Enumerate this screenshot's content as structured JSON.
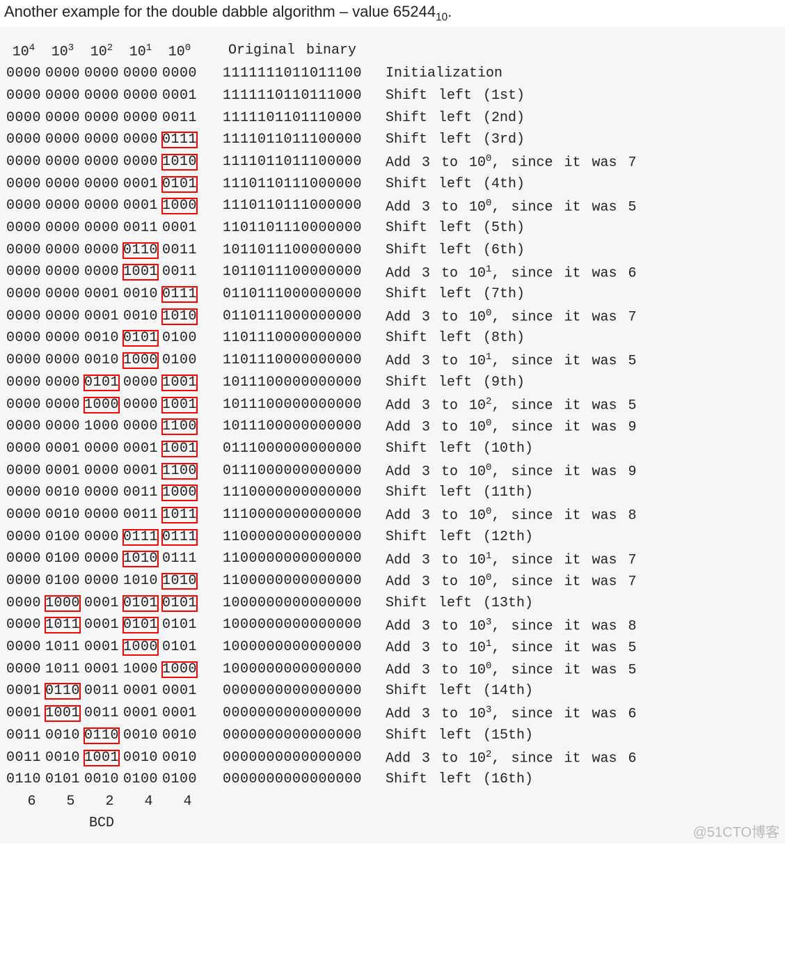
{
  "title_pre": "Another example for the double dabble algorithm – value 65244",
  "title_sub": "10",
  "title_post": ".",
  "header": {
    "cols": [
      "10",
      "10",
      "10",
      "10",
      "10"
    ],
    "exps": [
      "4",
      "3",
      "2",
      "1",
      "0"
    ],
    "bin": "Original binary"
  },
  "rows": [
    {
      "bcd": [
        "0000",
        "0000",
        "0000",
        "0000",
        "0000"
      ],
      "box": [
        0,
        0,
        0,
        0,
        0
      ],
      "bin": "1111111011011100",
      "desc": "Initialization"
    },
    {
      "bcd": [
        "0000",
        "0000",
        "0000",
        "0000",
        "0001"
      ],
      "box": [
        0,
        0,
        0,
        0,
        0
      ],
      "bin": "1111110110111000",
      "desc": "Shift left (1st)"
    },
    {
      "bcd": [
        "0000",
        "0000",
        "0000",
        "0000",
        "0011"
      ],
      "box": [
        0,
        0,
        0,
        0,
        0
      ],
      "bin": "1111101101110000",
      "desc": "Shift left (2nd)"
    },
    {
      "bcd": [
        "0000",
        "0000",
        "0000",
        "0000",
        "0111"
      ],
      "box": [
        0,
        0,
        0,
        0,
        1
      ],
      "bin": "1111011011100000",
      "desc": "Shift left (3rd)"
    },
    {
      "bcd": [
        "0000",
        "0000",
        "0000",
        "0000",
        "1010"
      ],
      "box": [
        0,
        0,
        0,
        0,
        1
      ],
      "bin": "1111011011100000",
      "desc": "Add 3 to 10",
      "exp": "0",
      "tail": ", since it was 7"
    },
    {
      "bcd": [
        "0000",
        "0000",
        "0000",
        "0001",
        "0101"
      ],
      "box": [
        0,
        0,
        0,
        0,
        1
      ],
      "bin": "1110110111000000",
      "desc": "Shift left (4th)"
    },
    {
      "bcd": [
        "0000",
        "0000",
        "0000",
        "0001",
        "1000"
      ],
      "box": [
        0,
        0,
        0,
        0,
        1
      ],
      "bin": "1110110111000000",
      "desc": "Add 3 to 10",
      "exp": "0",
      "tail": ", since it was 5"
    },
    {
      "bcd": [
        "0000",
        "0000",
        "0000",
        "0011",
        "0001"
      ],
      "box": [
        0,
        0,
        0,
        0,
        0
      ],
      "bin": "1101101110000000",
      "desc": "Shift left (5th)"
    },
    {
      "bcd": [
        "0000",
        "0000",
        "0000",
        "0110",
        "0011"
      ],
      "box": [
        0,
        0,
        0,
        1,
        0
      ],
      "bin": "1011011100000000",
      "desc": "Shift left (6th)"
    },
    {
      "bcd": [
        "0000",
        "0000",
        "0000",
        "1001",
        "0011"
      ],
      "box": [
        0,
        0,
        0,
        1,
        0
      ],
      "bin": "1011011100000000",
      "desc": "Add 3 to 10",
      "exp": "1",
      "tail": ", since it was 6"
    },
    {
      "bcd": [
        "0000",
        "0000",
        "0001",
        "0010",
        "0111"
      ],
      "box": [
        0,
        0,
        0,
        0,
        1
      ],
      "bin": "0110111000000000",
      "desc": "Shift left (7th)"
    },
    {
      "bcd": [
        "0000",
        "0000",
        "0001",
        "0010",
        "1010"
      ],
      "box": [
        0,
        0,
        0,
        0,
        1
      ],
      "bin": "0110111000000000",
      "desc": "Add 3 to 10",
      "exp": "0",
      "tail": ", since it was 7"
    },
    {
      "bcd": [
        "0000",
        "0000",
        "0010",
        "0101",
        "0100"
      ],
      "box": [
        0,
        0,
        0,
        1,
        0
      ],
      "bin": "1101110000000000",
      "desc": "Shift left (8th)"
    },
    {
      "bcd": [
        "0000",
        "0000",
        "0010",
        "1000",
        "0100"
      ],
      "box": [
        0,
        0,
        0,
        1,
        0
      ],
      "bin": "1101110000000000",
      "desc": "Add 3 to 10",
      "exp": "1",
      "tail": ", since it was 5"
    },
    {
      "bcd": [
        "0000",
        "0000",
        "0101",
        "0000",
        "1001"
      ],
      "box": [
        0,
        0,
        1,
        0,
        1
      ],
      "bin": "1011100000000000",
      "desc": "Shift left (9th)"
    },
    {
      "bcd": [
        "0000",
        "0000",
        "1000",
        "0000",
        "1001"
      ],
      "box": [
        0,
        0,
        1,
        0,
        1
      ],
      "bin": "1011100000000000",
      "desc": "Add 3 to 10",
      "exp": "2",
      "tail": ", since it was 5"
    },
    {
      "bcd": [
        "0000",
        "0000",
        "1000",
        "0000",
        "1100"
      ],
      "box": [
        0,
        0,
        0,
        0,
        1
      ],
      "bin": "1011100000000000",
      "desc": "Add 3 to 10",
      "exp": "0",
      "tail": ", since it was 9"
    },
    {
      "bcd": [
        "0000",
        "0001",
        "0000",
        "0001",
        "1001"
      ],
      "box": [
        0,
        0,
        0,
        0,
        1
      ],
      "bin": "0111000000000000",
      "desc": "Shift left (10th)"
    },
    {
      "bcd": [
        "0000",
        "0001",
        "0000",
        "0001",
        "1100"
      ],
      "box": [
        0,
        0,
        0,
        0,
        1
      ],
      "bin": "0111000000000000",
      "desc": "Add 3 to 10",
      "exp": "0",
      "tail": ", since it was 9"
    },
    {
      "bcd": [
        "0000",
        "0010",
        "0000",
        "0011",
        "1000"
      ],
      "box": [
        0,
        0,
        0,
        0,
        1
      ],
      "bin": "1110000000000000",
      "desc": "Shift left (11th)"
    },
    {
      "bcd": [
        "0000",
        "0010",
        "0000",
        "0011",
        "1011"
      ],
      "box": [
        0,
        0,
        0,
        0,
        1
      ],
      "bin": "1110000000000000",
      "desc": "Add 3 to 10",
      "exp": "0",
      "tail": ", since it was 8"
    },
    {
      "bcd": [
        "0000",
        "0100",
        "0000",
        "0111",
        "0111"
      ],
      "box": [
        0,
        0,
        0,
        1,
        1
      ],
      "bin": "1100000000000000",
      "desc": "Shift left (12th)"
    },
    {
      "bcd": [
        "0000",
        "0100",
        "0000",
        "1010",
        "0111"
      ],
      "box": [
        0,
        0,
        0,
        1,
        0
      ],
      "bin": "1100000000000000",
      "desc": "Add 3 to 10",
      "exp": "1",
      "tail": ", since it was 7"
    },
    {
      "bcd": [
        "0000",
        "0100",
        "0000",
        "1010",
        "1010"
      ],
      "box": [
        0,
        0,
        0,
        0,
        1
      ],
      "bin": "1100000000000000",
      "desc": "Add 3 to 10",
      "exp": "0",
      "tail": ", since it was 7"
    },
    {
      "bcd": [
        "0000",
        "1000",
        "0001",
        "0101",
        "0101"
      ],
      "box": [
        0,
        1,
        0,
        1,
        1
      ],
      "bin": "1000000000000000",
      "desc": "Shift left (13th)"
    },
    {
      "bcd": [
        "0000",
        "1011",
        "0001",
        "0101",
        "0101"
      ],
      "box": [
        0,
        1,
        0,
        1,
        0
      ],
      "bin": "1000000000000000",
      "desc": "Add 3 to 10",
      "exp": "3",
      "tail": ", since it was 8"
    },
    {
      "bcd": [
        "0000",
        "1011",
        "0001",
        "1000",
        "0101"
      ],
      "box": [
        0,
        0,
        0,
        1,
        0
      ],
      "bin": "1000000000000000",
      "desc": "Add 3 to 10",
      "exp": "1",
      "tail": ", since it was 5"
    },
    {
      "bcd": [
        "0000",
        "1011",
        "0001",
        "1000",
        "1000"
      ],
      "box": [
        0,
        0,
        0,
        0,
        1
      ],
      "bin": "1000000000000000",
      "desc": "Add 3 to 10",
      "exp": "0",
      "tail": ", since it was 5"
    },
    {
      "bcd": [
        "0001",
        "0110",
        "0011",
        "0001",
        "0001"
      ],
      "box": [
        0,
        1,
        0,
        0,
        0
      ],
      "bin": "0000000000000000",
      "desc": "Shift left (14th)"
    },
    {
      "bcd": [
        "0001",
        "1001",
        "0011",
        "0001",
        "0001"
      ],
      "box": [
        0,
        1,
        0,
        0,
        0
      ],
      "bin": "0000000000000000",
      "desc": "Add 3 to 10",
      "exp": "3",
      "tail": ", since it was 6"
    },
    {
      "bcd": [
        "0011",
        "0010",
        "0110",
        "0010",
        "0010"
      ],
      "box": [
        0,
        0,
        1,
        0,
        0
      ],
      "bin": "0000000000000000",
      "desc": "Shift left (15th)"
    },
    {
      "bcd": [
        "0011",
        "0010",
        "1001",
        "0010",
        "0010"
      ],
      "box": [
        0,
        0,
        1,
        0,
        0
      ],
      "bin": "0000000000000000",
      "desc": "Add 3 to 10",
      "exp": "2",
      "tail": ", since it was 6"
    },
    {
      "bcd": [
        "0110",
        "0101",
        "0010",
        "0100",
        "0100"
      ],
      "box": [
        0,
        0,
        0,
        0,
        0
      ],
      "bin": "0000000000000000",
      "desc": "Shift left (16th)"
    }
  ],
  "digits": [
    "6",
    "5",
    "2",
    "4",
    "4"
  ],
  "bcd_label": "BCD",
  "watermark": "@51CTO博客"
}
